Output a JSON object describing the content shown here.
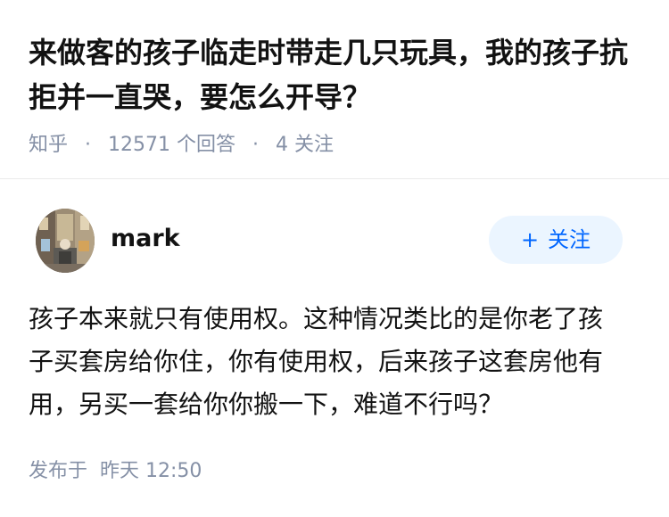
{
  "question": {
    "title": "来做客的孩子临走时带走几只玩具，我的孩子抗拒并一直哭，要怎么开导？",
    "source": "知乎",
    "answer_count": "12571",
    "answer_count_suffix": "个回答",
    "follow_count": "4",
    "follow_count_suffix": "关注",
    "separator": "·"
  },
  "answer": {
    "author": {
      "name": "mark",
      "follow_plus": "+",
      "follow_label": "关注"
    },
    "content": "孩子本来就只有使用权。这种情况类比的是你老了孩子买套房给你住，你有使用权，后来孩子这套房他有用，另买一套给你你搬一下，难道不行吗？",
    "published_prefix": "发布于",
    "published_time": "昨天 12:50"
  },
  "colors": {
    "text_primary": "#121212",
    "text_secondary": "#8590a6",
    "brand_blue": "#0066ff",
    "follow_bg": "#ebf5ff",
    "divider": "#ebebeb"
  }
}
